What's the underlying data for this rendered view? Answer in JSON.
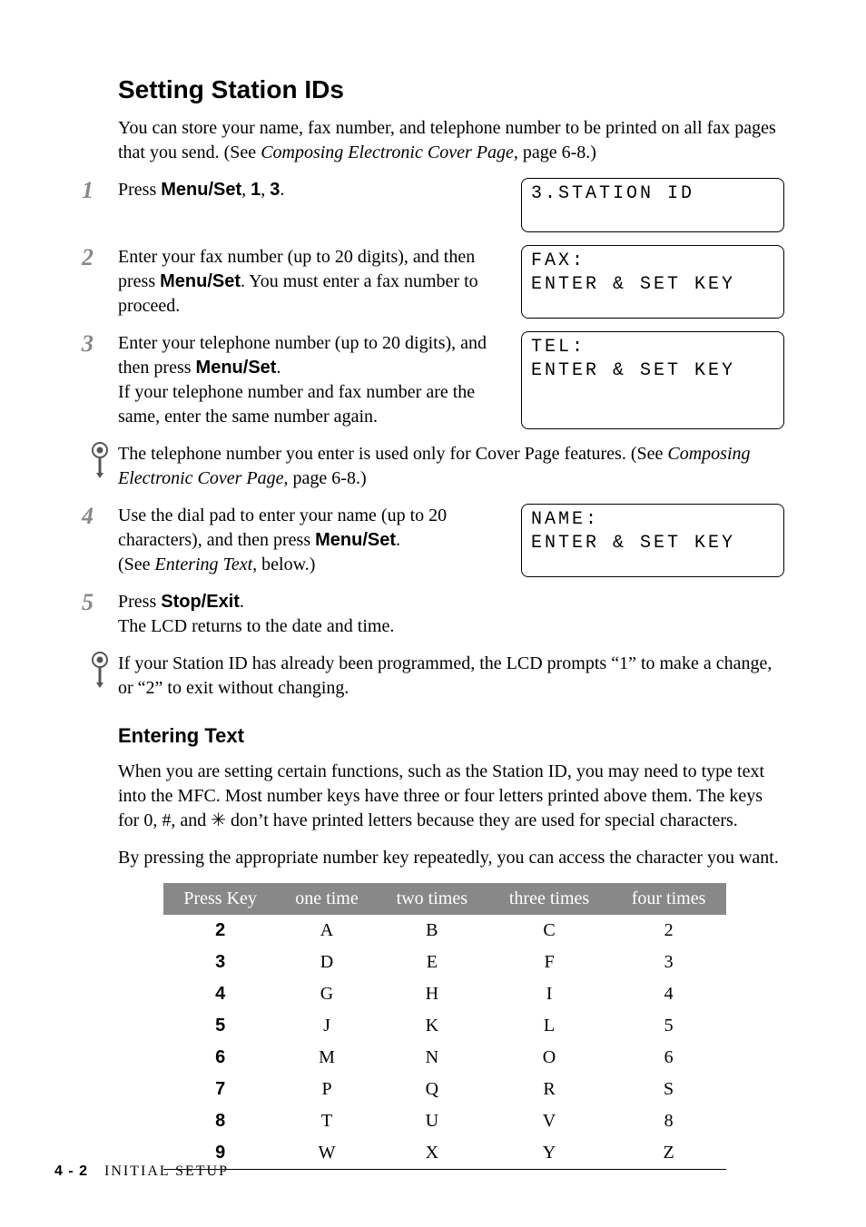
{
  "title": "Setting Station IDs",
  "intro_a": "You can store your name, fax number, and telephone number to be printed on all fax pages that you send. (See ",
  "intro_ref": "Composing Electronic Cover Page",
  "intro_b": ", page 6-8.)",
  "steps": {
    "s1": {
      "num": "1",
      "t1": "Press ",
      "b1": "Menu/Set",
      "t2": ", ",
      "b2": "1",
      "t3": ", ",
      "b3": "3",
      "t4": ".",
      "lcd": "3.STATION ID\n"
    },
    "s2": {
      "num": "2",
      "t1": "Enter your fax number (up to 20 digits), and then press ",
      "b1": "Menu/Set",
      "t2": ". You must enter a fax number to proceed.",
      "lcd": "FAX:\nENTER & SET KEY"
    },
    "s3": {
      "num": "3",
      "t1": "Enter your telephone number (up to 20 digits), and then press ",
      "b1": "Menu/Set",
      "t2": ".",
      "t3": "If your telephone number and fax number are the same, enter the same number again.",
      "lcd": "TEL:\nENTER & SET KEY"
    },
    "s4": {
      "num": "4",
      "t1": "Use the dial pad to enter your name (up to 20 characters), and then press ",
      "b1": "Menu/Set",
      "t2": ".",
      "t3": "(See ",
      "i1": "Entering Text,",
      "t4": " below.)",
      "lcd": "NAME:\nENTER & SET KEY"
    },
    "s5": {
      "num": "5",
      "t1": "Press ",
      "b1": "Stop/Exit",
      "t2": ".",
      "t3": "The LCD returns to the date and time."
    }
  },
  "note1": {
    "t1": "The telephone number you enter is used only for Cover Page features. (See ",
    "i1": "Composing Electronic Cover Page",
    "t2": ", page 6-8.)"
  },
  "note2": {
    "t1": "If your Station ID has already been programmed, the LCD prompts “1” to make a change, or “2” to exit without changing."
  },
  "entering_text": {
    "heading": "Entering Text",
    "p1": "When you are setting certain functions, such as the Station ID, you may need to type text into the MFC. Most number keys have three or four letters printed above them. The keys for 0, #, and ✳ don’t have printed letters because they are used for special characters.",
    "p2": "By pressing the appropriate number key repeatedly, you can access the character you want."
  },
  "table": {
    "headers": [
      "Press Key",
      "one time",
      "two times",
      "three times",
      "four times"
    ],
    "rows": [
      [
        "2",
        "A",
        "B",
        "C",
        "2"
      ],
      [
        "3",
        "D",
        "E",
        "F",
        "3"
      ],
      [
        "4",
        "G",
        "H",
        "I",
        "4"
      ],
      [
        "5",
        "J",
        "K",
        "L",
        "5"
      ],
      [
        "6",
        "M",
        "N",
        "O",
        "6"
      ],
      [
        "7",
        "P",
        "Q",
        "R",
        "S"
      ],
      [
        "8",
        "T",
        "U",
        "V",
        "8"
      ],
      [
        "9",
        "W",
        "X",
        "Y",
        "Z"
      ]
    ]
  },
  "footer": {
    "page": "4 - 2",
    "section": "INITIAL SETUP"
  }
}
